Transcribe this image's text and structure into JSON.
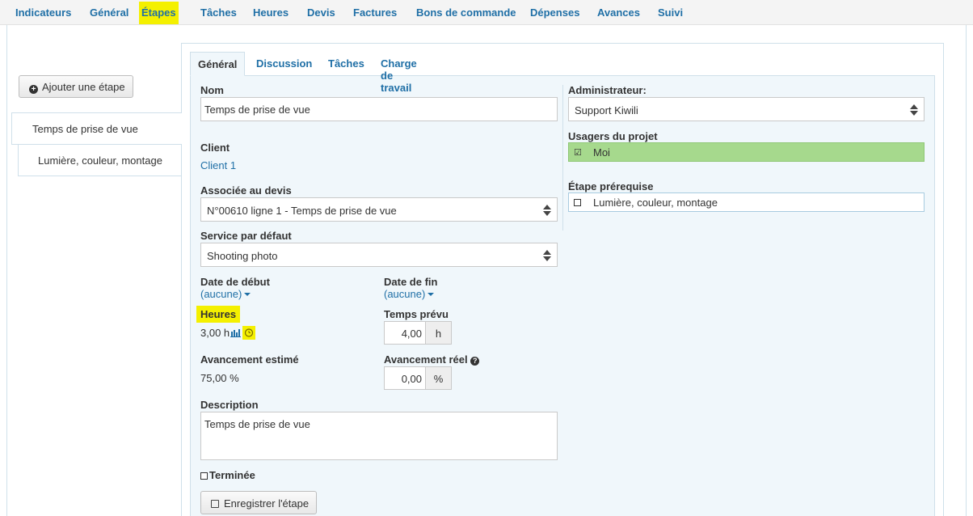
{
  "nav": {
    "items": [
      "Indicateurs",
      "Général",
      "Étapes",
      "Tâches",
      "Heures",
      "Devis",
      "Factures",
      "Bons de commande",
      "Dépenses",
      "Avances",
      "Suivi"
    ],
    "active": "Étapes"
  },
  "sidebar": {
    "add_label": "Ajouter une étape",
    "steps": [
      "Temps de prise de vue",
      "Lumière, couleur, montage"
    ]
  },
  "tabs": [
    "Général",
    "Discussion",
    "Tâches",
    "Charge de travail"
  ],
  "form": {
    "nom_label": "Nom",
    "nom_value": "Temps de prise de vue",
    "client_label": "Client",
    "client_value": "Client 1",
    "devis_label": "Associée au devis",
    "devis_value": "N°00610 ligne 1 - Temps de prise de vue",
    "service_label": "Service par défaut",
    "service_value": "Shooting photo",
    "date_debut_label": "Date de début",
    "date_debut_value": "(aucune)",
    "date_fin_label": "Date de fin",
    "date_fin_value": "(aucune)",
    "heures_label": "Heures",
    "heures_value": "3,00 h",
    "temps_prevu_label": "Temps prévu",
    "temps_prevu_value": "4,00",
    "temps_prevu_unit": "h",
    "avancement_estime_label": "Avancement estimé",
    "avancement_estime_value": "75,00 %",
    "avancement_reel_label": "Avancement réel",
    "avancement_reel_value": "0,00",
    "avancement_reel_unit": "%",
    "description_label": "Description",
    "description_value": "Temps de prise de vue",
    "terminee_label": "Terminée",
    "save_label": "Enregistrer l'étape",
    "admin_label": "Administrateur:",
    "admin_value": "Support Kiwili",
    "usagers_label": "Usagers du projet",
    "usager_value": "Moi",
    "prereq_label": "Étape prérequise",
    "prereq_value": "Lumière, couleur, montage"
  },
  "colors": {
    "link": "#1f6fa6",
    "highlight": "#f4f000",
    "selected_user": "#a6d98d",
    "panel_bg": "#f0f7fb"
  }
}
